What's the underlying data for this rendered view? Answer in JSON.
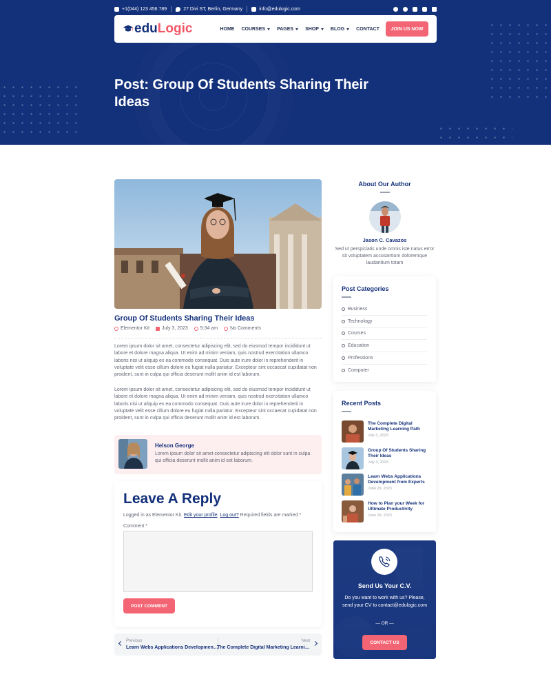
{
  "topbar": {
    "phone": "+1(044) 123 456 789",
    "address": "27 Divi ST, Berlin, Germany",
    "email": "info@edulogic.com",
    "socials": [
      "facebook-icon",
      "twitter-icon",
      "youtube-icon",
      "instagram-icon",
      "linkedin-icon"
    ]
  },
  "nav": {
    "logo_prefix": "edu",
    "logo_suffix": "Logic",
    "items": [
      {
        "label": "HOME"
      },
      {
        "label": "COURSES"
      },
      {
        "label": "PAGES"
      },
      {
        "label": "SHOP"
      },
      {
        "label": "BLOG"
      },
      {
        "label": "CONTACT"
      }
    ],
    "cta": "JOIN US NOW"
  },
  "hero": {
    "title": "Post: Group Of Students Sharing Their Ideas"
  },
  "post": {
    "title": "Group Of Students Sharing Their Ideas",
    "author": "Elementor Kit",
    "date": "July 3, 2023",
    "time": "5:34 am",
    "comments": "No Comments",
    "paragraphs": [
      "Lorem ipsum dolor sit amet, consectetur adipiscing elit, sed do eiusmod tempor incididunt ut labore et dolore magna aliqua. Ut enim ad minim veniam, quis nostrud exercitation ullamco laboris nisi ut aliquip ex ea commodo consequat. Duis aute irure dolor in reprehenderit in voluptate velit esse cillum dolore eu fugiat nulla pariatur. Excepteur sint occaecat cupidatat non proident, sunt in culpa qui officia deserunt mollit anim id est laborum.",
      "Lorem ipsum dolor sit amet, consectetur adipiscing elit, sed do eiusmod tempor incididunt ut labore et dolore magna aliqua. Ut enim ad minim veniam, quis nostrud exercitation ullamco laboris nisi ut aliquip ex ea commodo consequat. Duis aute irure dolor in reprehenderit in voluptate velit esse cillum dolore eu fugiat nulla pariatur. Excepteur sint occaecat cupidatat non proident, sunt in culpa qui officia deserunt mollit anim id est laborum."
    ]
  },
  "author_box": {
    "name": "Helson George",
    "bio": "Lorem ipsum dolor sit amet consectetur adipiscing elit dolor sunt in culpa qui officia deserunt mollit anim id est laborum."
  },
  "reply": {
    "heading": "Leave A Reply",
    "logged_in_prefix": "Logged in as Elementor Kit. ",
    "edit_profile": "Edit your profile",
    "logout": "Log out?",
    "required_note": " Required fields are marked *",
    "comment_label": "Comment *",
    "submit": "POST COMMENT"
  },
  "post_nav": {
    "prev_label": "Previous",
    "prev_title": "Learn Webs Applications Development from Experts",
    "next_label": "Next",
    "next_title": "The Complete Digital Marketing Learning Path"
  },
  "sidebar": {
    "about": {
      "heading": "About Our Author",
      "name": "Jason C. Cavazos",
      "bio": "Sed ut perspiciatis unde omnis iste natus error sit voluptatem accusantium doloremque laudantium totam"
    },
    "categories": {
      "heading": "Post Categories",
      "items": [
        "Business",
        "Technology",
        "Courses",
        "Education",
        "Professions",
        "Computer"
      ]
    },
    "recent": {
      "heading": "Recent Posts",
      "items": [
        {
          "title": "The Complete Digital Marketing Learning Path",
          "date": "July 3, 2023"
        },
        {
          "title": "Group Of Students Sharing Their Ideas",
          "date": "July 3, 2023"
        },
        {
          "title": "Learn Webs Applications Development from Experts",
          "date": "June 29, 2023"
        },
        {
          "title": "How to Plan your Week for Ultimate Productivity",
          "date": "June 29, 2023"
        }
      ]
    },
    "cv": {
      "heading": "Send Us Your C.V.",
      "text": "Do you want to work with us? Please, send your CV to contact@edulogic.com",
      "or": "— OR —",
      "button": "CONTACT US"
    }
  },
  "colors": {
    "primary": "#13307a",
    "accent": "#f36574",
    "author_bg": "#fdeff0"
  }
}
